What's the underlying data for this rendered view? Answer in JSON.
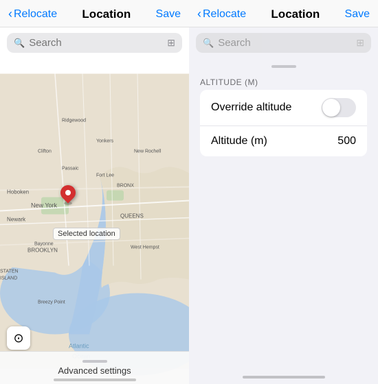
{
  "left": {
    "nav": {
      "back_label": "Relocate",
      "title": "Location",
      "action_label": "Save"
    },
    "search": {
      "placeholder": "Search",
      "map_icon": "⊞"
    },
    "map": {
      "selected_location_label": "Selected location",
      "pin_alt": "map-pin"
    },
    "bottom": {
      "location_icon": "⊙",
      "advanced_label": "Advanced settings"
    }
  },
  "right": {
    "nav": {
      "back_label": "Relocate",
      "title": "Location",
      "action_label": "Save"
    },
    "search": {
      "placeholder": "Search"
    },
    "altitude_section": {
      "label": "ALTITUDE (M)",
      "override_label": "Override altitude",
      "altitude_label": "Altitude (m)",
      "altitude_value": "500"
    }
  }
}
